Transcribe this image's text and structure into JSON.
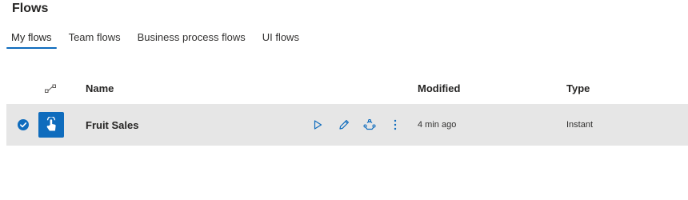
{
  "page": {
    "title": "Flows"
  },
  "tabs": [
    {
      "label": "My flows",
      "active": true
    },
    {
      "label": "Team flows"
    },
    {
      "label": "Business process flows"
    },
    {
      "label": "UI flows"
    }
  ],
  "table": {
    "columns": {
      "connector": "connector-icon",
      "name": "Name",
      "modified": "Modified",
      "type": "Type"
    },
    "rows": [
      {
        "selected": true,
        "icon": "touch-hand-icon",
        "name": "Fruit Sales",
        "actions": [
          "run-icon",
          "edit-icon",
          "share-icon",
          "more-icon"
        ],
        "modified": "4 min ago",
        "type": "Instant"
      }
    ]
  },
  "colors": {
    "accent": "#0f6cbd",
    "row_selected_bg": "#e6e6e6"
  }
}
